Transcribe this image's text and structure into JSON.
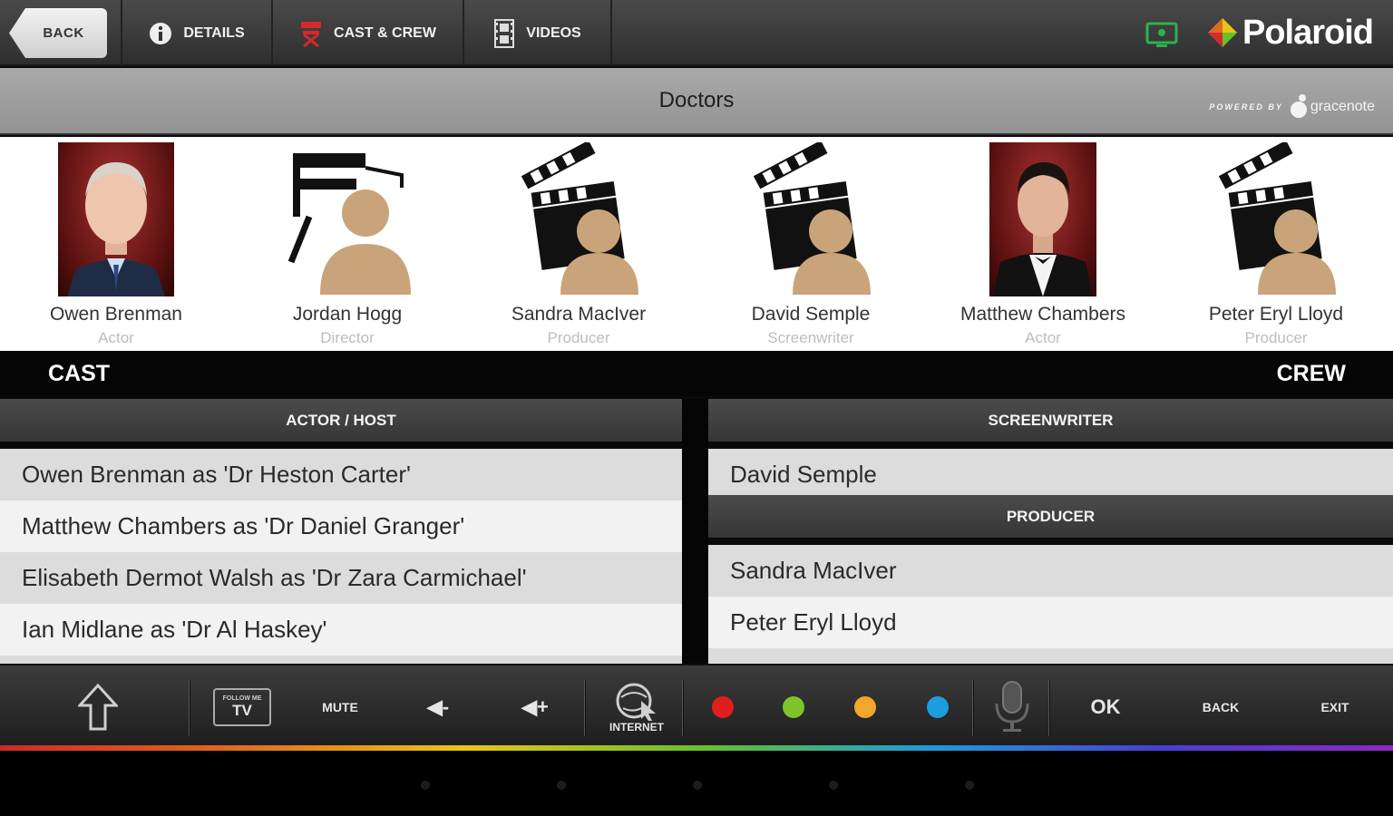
{
  "nav": {
    "back_label": "BACK",
    "tabs": [
      {
        "label": "DETAILS",
        "icon": "info-icon"
      },
      {
        "label": "CAST & CREW",
        "icon": "director-chair-icon"
      },
      {
        "label": "VIDEOS",
        "icon": "film-strip-icon"
      }
    ],
    "tv_icon": "tv-screen-icon",
    "brand": "Polaroid"
  },
  "titlebar": {
    "title": "Doctors",
    "powered_by": "POWERED BY",
    "provider": "gracenote"
  },
  "gallery": [
    {
      "name": "Owen Brenman",
      "role": "Actor",
      "image": "photo"
    },
    {
      "name": "Jordan Hogg",
      "role": "Director",
      "image": "director-chair-person-icon"
    },
    {
      "name": "Sandra MacIver",
      "role": "Producer",
      "image": "clapperboard-person-icon"
    },
    {
      "name": "David Semple",
      "role": "Screenwriter",
      "image": "clapperboard-person-icon"
    },
    {
      "name": "Matthew Chambers",
      "role": "Actor",
      "image": "photo"
    },
    {
      "name": "Peter Eryl Lloyd",
      "role": "Producer",
      "image": "clapperboard-person-icon"
    }
  ],
  "sections": {
    "cast": "CAST",
    "crew": "CREW"
  },
  "cast_list": {
    "header": "ACTOR / HOST",
    "rows": [
      "Owen Brenman as 'Dr Heston Carter'",
      "Matthew Chambers as 'Dr Daniel Granger'",
      "Elisabeth Dermot Walsh as 'Dr Zara Carmichael'",
      "Ian Midlane as 'Dr Al Haskey'"
    ]
  },
  "crew_list": {
    "screenwriter_header": "SCREENWRITER",
    "screenwriters": [
      "David Semple"
    ],
    "producer_header": "PRODUCER",
    "producers": [
      "Sandra MacIver",
      "Peter Eryl Lloyd"
    ]
  },
  "remote": {
    "up_icon": "arrow-up-icon",
    "tv_badge_top": "FOLLOW ME",
    "tv_badge": "TV",
    "mute": "MUTE",
    "vol_down": "◀-",
    "vol_up": "◀+",
    "internet": "INTERNET",
    "colors": [
      "#e01e1e",
      "#7fc428",
      "#f2a62a",
      "#1e9ce0"
    ],
    "mic_icon": "microphone-icon",
    "ok": "OK",
    "back": "BACK",
    "exit": "EXIT"
  }
}
